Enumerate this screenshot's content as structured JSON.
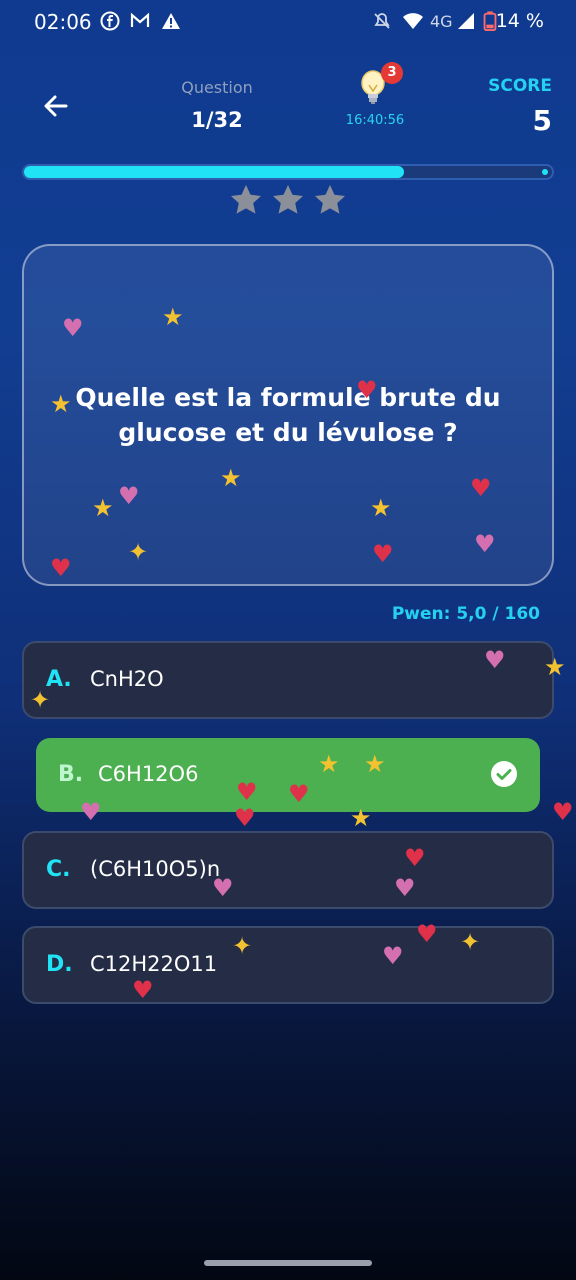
{
  "status_bar": {
    "time": "02:06",
    "network": "4G",
    "battery": "14 %"
  },
  "header": {
    "question_label": "Question",
    "question_progress": "1/32",
    "hint_count": "3",
    "timer": "16:40:56",
    "score_label": "SCORE",
    "score_value": "5"
  },
  "progress": {
    "fraction": 0.72,
    "stars_earned": 0,
    "stars_total": 3
  },
  "question": {
    "text": "Quelle est la formule brute du glucose et du lévulose ?"
  },
  "points_text": "Pwen: 5,0 / 160",
  "answers": [
    {
      "letter": "A.",
      "text": "CnH2O",
      "state": "default"
    },
    {
      "letter": "B.",
      "text": "C6H12O6",
      "state": "correct"
    },
    {
      "letter": "C.",
      "text": "(C6H10O5)n",
      "state": "default"
    },
    {
      "letter": "D.",
      "text": "C12H22O11",
      "state": "default"
    }
  ],
  "colors": {
    "accent": "#20e3f5",
    "correct": "#4caf50",
    "badge": "#e53935",
    "answer_bg": "#252c45"
  },
  "icons": [
    "back-arrow-icon",
    "lightbulb-icon",
    "star-icon",
    "check-circle-icon",
    "facebook-icon",
    "gmail-icon",
    "warning-icon",
    "mute-icon",
    "wifi-icon",
    "signal-icon",
    "battery-icon"
  ]
}
